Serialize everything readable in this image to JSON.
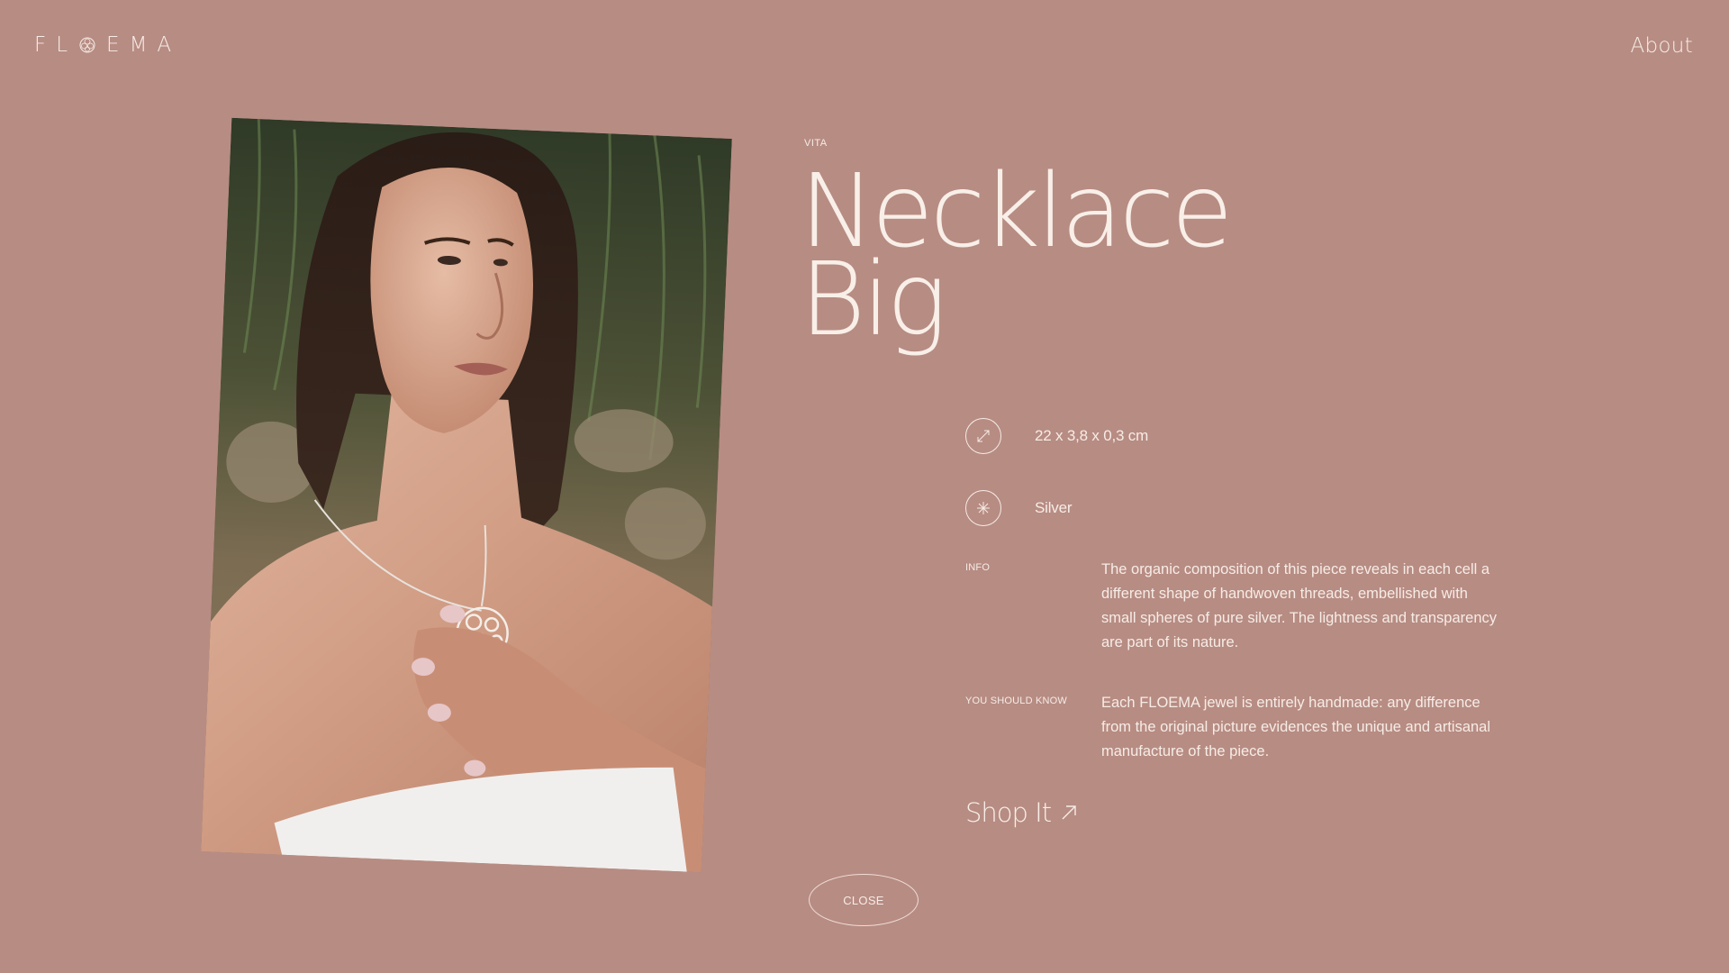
{
  "header": {
    "logo_left": "FL",
    "logo_right": "EMA",
    "nav_about": "About"
  },
  "product": {
    "collection": "VITA",
    "title_line1": "Necklace",
    "title_line2": "Big",
    "dimensions": "22 x 3,8 x 0,3 cm",
    "material": "Silver",
    "info_label": "INFO",
    "info_text": "The organic composition of this piece reveals in each cell a different shape of handwoven threads, embellished with small spheres of pure silver. The lightness and transparency are part of its nature.",
    "know_label": "YOU SHOULD KNOW",
    "know_text": "Each FLOEMA jewel is entirely handmade: any difference from the original picture evidences the unique and artisanal manufacture of the piece.",
    "shop_label": "Shop It"
  },
  "actions": {
    "close_label": "CLOSE"
  },
  "icons": {
    "logo_mark": "flower-gem-icon",
    "dimensions": "diagonal-resize-icon",
    "material": "sparkle-icon",
    "shop": "arrow-up-right-icon"
  },
  "colors": {
    "background": "#b78c83",
    "text": "#f6ece6"
  }
}
